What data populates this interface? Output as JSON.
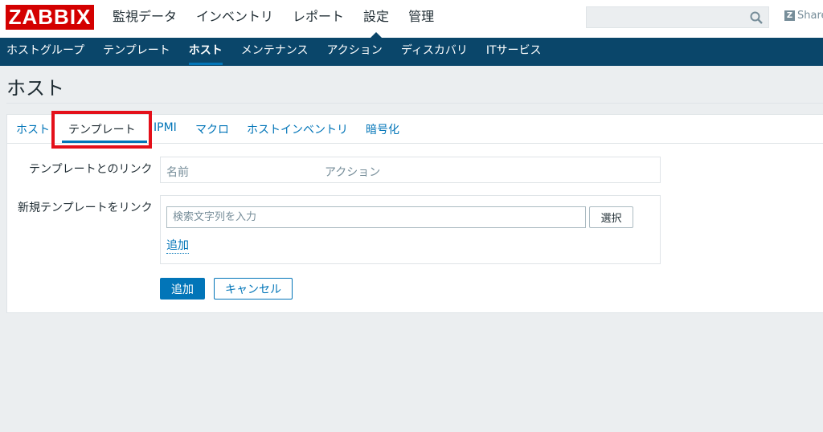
{
  "header": {
    "logo_text": "ZABBIX",
    "main_menu": [
      "監視データ",
      "インベントリ",
      "レポート",
      "設定",
      "管理"
    ],
    "active_menu": "設定",
    "share_text": "Share",
    "share_badge": "Z"
  },
  "submenu": {
    "items": [
      "ホストグループ",
      "テンプレート",
      "ホスト",
      "メンテナンス",
      "アクション",
      "ディスカバリ",
      "ITサービス"
    ],
    "active": "ホスト"
  },
  "page": {
    "title": "ホスト"
  },
  "tabs": {
    "items": [
      "ホスト",
      "テンプレート",
      "IPMI",
      "マクロ",
      "ホストインベントリ",
      "暗号化"
    ],
    "active": "テンプレート"
  },
  "form": {
    "linked_templates_label": "テンプレートとのリンク",
    "col_name": "名前",
    "col_action": "アクション",
    "new_template_label": "新規テンプレートをリンク",
    "search_placeholder": "検索文字列を入力",
    "select_button": "選択",
    "add_link": "追加",
    "submit_button": "追加",
    "cancel_button": "キャンセル"
  },
  "colors": {
    "brand_red": "#d40000",
    "nav_bg": "#0a466a",
    "accent_blue": "#0275b8",
    "highlight_red": "#e4101a"
  }
}
